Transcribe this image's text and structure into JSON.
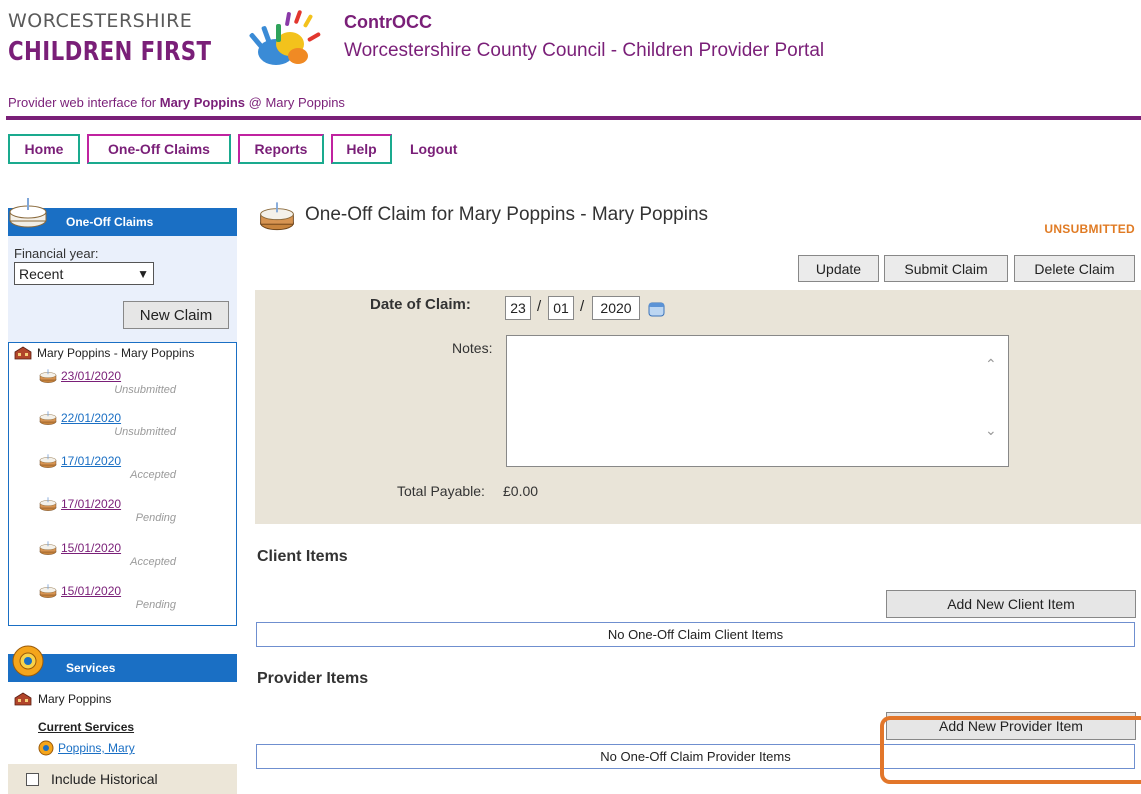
{
  "header": {
    "logo_line1": "WORCESTERSHIRE",
    "logo_line2": "CHILDREN FIRST",
    "app_name": "ContrOCC",
    "portal_title": "Worcestershire County Council - Children Provider Portal",
    "provider_prefix": "Provider web interface for",
    "provider_name": "Mary Poppins",
    "provider_sep": "@",
    "provider_org": "Mary Poppins"
  },
  "nav": {
    "home": "Home",
    "one_off_claims": "One-Off Claims",
    "reports": "Reports",
    "help": "Help",
    "logout": "Logout"
  },
  "sidebar": {
    "claims_panel_title": "One-Off Claims",
    "financial_year_label": "Financial year:",
    "financial_year_value": "Recent",
    "new_claim_label": "New Claim",
    "root_label": "Mary Poppins - Mary Poppins",
    "claims": [
      {
        "date": "23/01/2020",
        "status": "Unsubmitted",
        "visited": true
      },
      {
        "date": "22/01/2020",
        "status": "Unsubmitted",
        "visited": false
      },
      {
        "date": "17/01/2020",
        "status": "Accepted",
        "visited": false
      },
      {
        "date": "17/01/2020",
        "status": "Pending",
        "visited": true
      },
      {
        "date": "15/01/2020",
        "status": "Accepted",
        "visited": true
      },
      {
        "date": "15/01/2020",
        "status": "Pending",
        "visited": true
      }
    ],
    "services_panel_title": "Services",
    "services_name": "Mary Poppins",
    "current_services_label": "Current Services",
    "service_link": "Poppins, Mary",
    "include_historical_label": "Include Historical"
  },
  "main": {
    "title": "One-Off Claim for Mary Poppins - Mary Poppins",
    "status": "UNSUBMITTED",
    "buttons": {
      "update": "Update",
      "submit": "Submit Claim",
      "delete": "Delete Claim"
    },
    "date_label": "Date of Claim:",
    "date_day": "23",
    "date_month": "01",
    "date_year": "2020",
    "notes_label": "Notes:",
    "notes_value": "",
    "total_label": "Total Payable:",
    "total_value": "£0.00",
    "client_items_title": "Client Items",
    "add_client_item": "Add New Client Item",
    "no_client_items": "No One-Off Claim Client Items",
    "provider_items_title": "Provider Items",
    "add_provider_item": "Add New Provider Item",
    "no_provider_items": "No One-Off Claim Provider Items"
  },
  "colors": {
    "brand_purple": "#7a1f78",
    "panel_blue": "#1a6fc4",
    "status_orange": "#e07b24",
    "highlight_orange": "#e2762a"
  }
}
